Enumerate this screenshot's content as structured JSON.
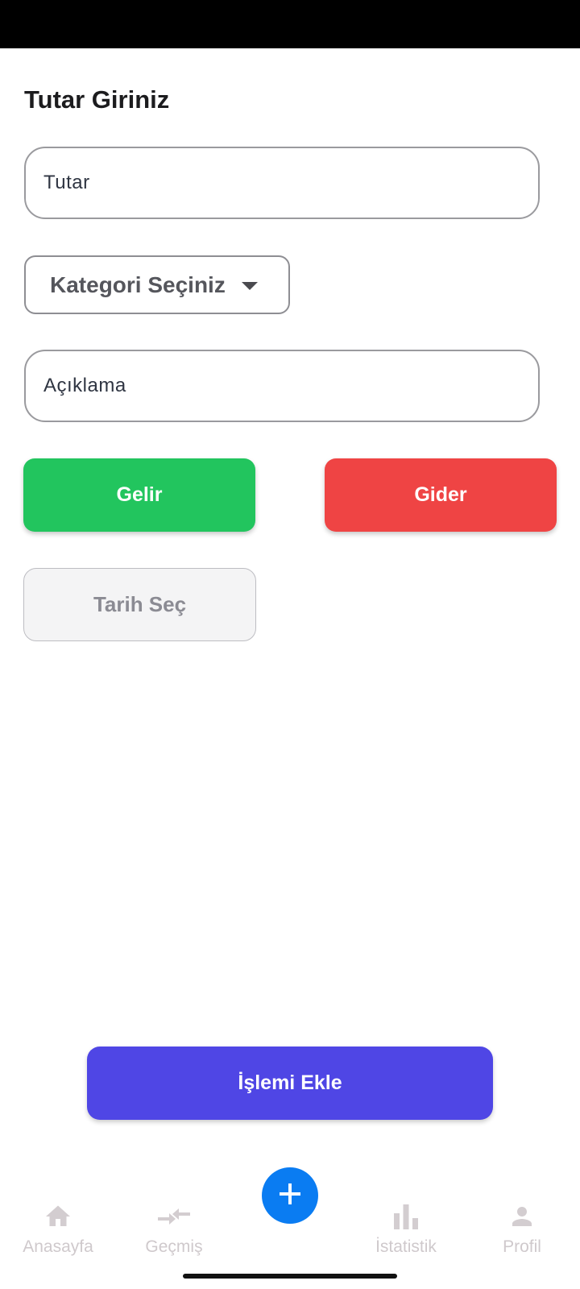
{
  "form": {
    "title": "Tutar Giriniz",
    "amount_placeholder": "Tutar",
    "category_label": "Kategori Seçiniz",
    "description_placeholder": "Açıklama",
    "income_label": "Gelir",
    "expense_label": "Gider",
    "date_label": "Tarih Seç",
    "submit_label": "İşlemi Ekle"
  },
  "nav": {
    "items": [
      {
        "label": "Anasayfa",
        "icon": "home-icon"
      },
      {
        "label": "Geçmiş",
        "icon": "swap-arrows-icon"
      },
      {
        "label": "",
        "icon": "plus-icon"
      },
      {
        "label": "İstatistik",
        "icon": "bar-chart-icon"
      },
      {
        "label": "Profil",
        "icon": "person-icon"
      }
    ]
  },
  "colors": {
    "income": "#22c55e",
    "expense": "#ef4444",
    "primary": "#4f46e5",
    "fab": "#0a7cf2",
    "nav_inactive": "#cfc9cc"
  }
}
